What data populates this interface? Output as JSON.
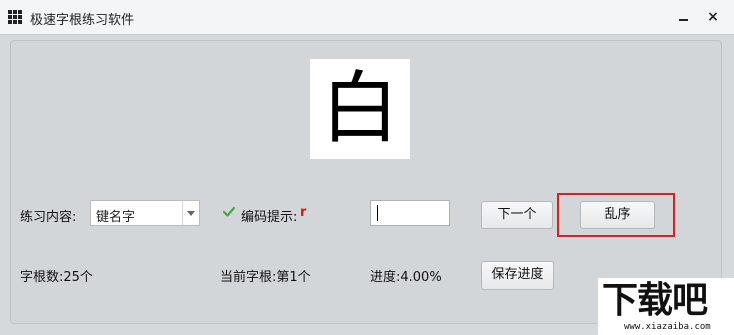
{
  "window": {
    "title": "极速字根练习软件",
    "minimize_icon": "minimize-icon",
    "close_label": "×"
  },
  "practice": {
    "character": "白",
    "content_label": "练习内容:",
    "content_value": "键名字",
    "hint_label": "编码提示:",
    "hint_value": "r",
    "input_value": "",
    "next_button": "下一个",
    "shuffle_button": "乱序"
  },
  "status": {
    "root_count": "字根数:25个",
    "current_root": "当前字根:第1个",
    "progress": "进度:4.00%",
    "save_button": "保存进度"
  },
  "watermark": {
    "big": "下载吧",
    "small": "www.xiazaiba.com"
  },
  "colors": {
    "highlight": "#e01e1e",
    "hint": "#d01818",
    "check": "#3cae3c"
  }
}
